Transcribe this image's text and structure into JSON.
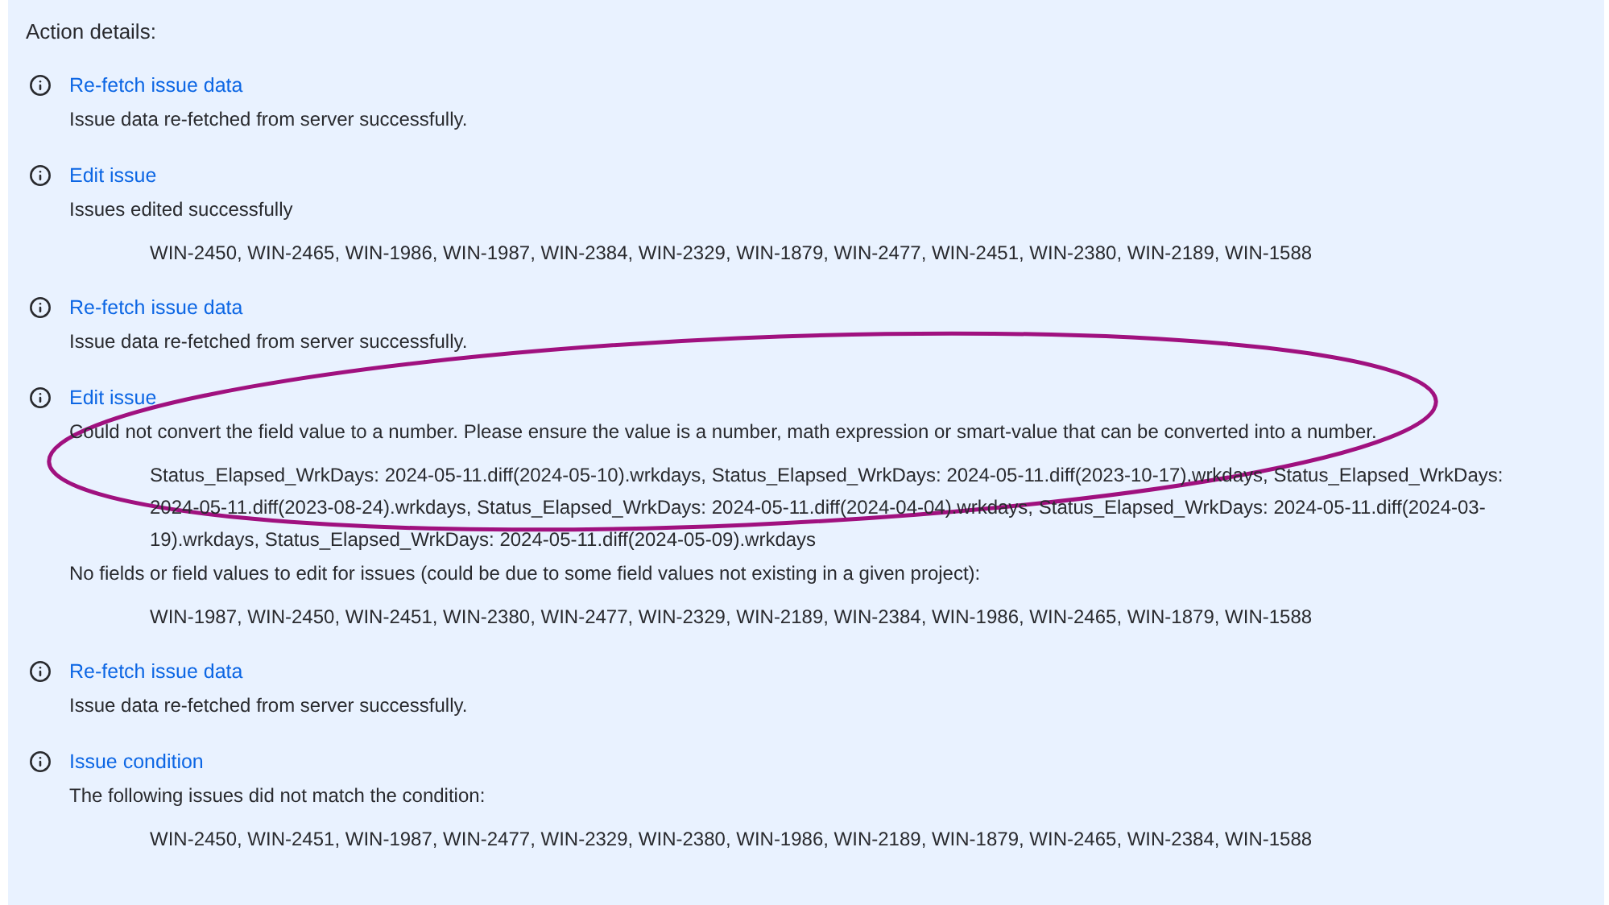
{
  "heading": "Action details:",
  "actions": [
    {
      "title": "Re-fetch issue data",
      "lines": [
        {
          "kind": "message",
          "text": "Issue data re-fetched from server successfully."
        }
      ]
    },
    {
      "title": "Edit issue",
      "lines": [
        {
          "kind": "message",
          "text": "Issues edited successfully"
        },
        {
          "kind": "detail",
          "text": "WIN-2450, WIN-2465, WIN-1986, WIN-1987, WIN-2384, WIN-2329, WIN-1879, WIN-2477, WIN-2451, WIN-2380, WIN-2189, WIN-1588"
        }
      ]
    },
    {
      "title": "Re-fetch issue data",
      "lines": [
        {
          "kind": "message",
          "text": "Issue data re-fetched from server successfully."
        }
      ]
    },
    {
      "title": "Edit issue",
      "lines": [
        {
          "kind": "message",
          "text": "Could not convert the field value to a number. Please ensure the value is a number, math expression or smart-value that can be converted into a number."
        },
        {
          "kind": "detail",
          "text": "Status_Elapsed_WrkDays: 2024-05-11.diff(2024-05-10).wrkdays, Status_Elapsed_WrkDays: 2024-05-11.diff(2023-10-17).wrkdays, Status_Elapsed_WrkDays: 2024-05-11.diff(2023-08-24).wrkdays, Status_Elapsed_WrkDays: 2024-05-11.diff(2024-04-04).wrkdays, Status_Elapsed_WrkDays: 2024-05-11.diff(2024-03-19).wrkdays, Status_Elapsed_WrkDays: 2024-05-11.diff(2024-05-09).wrkdays"
        },
        {
          "kind": "message",
          "text": "No fields or field values to edit for issues (could be due to some field values not existing in a given project):"
        },
        {
          "kind": "detail",
          "text": "WIN-1987, WIN-2450, WIN-2451, WIN-2380, WIN-2477, WIN-2329, WIN-2189, WIN-2384, WIN-1986, WIN-2465, WIN-1879, WIN-1588"
        }
      ],
      "circled": true
    },
    {
      "title": "Re-fetch issue data",
      "lines": [
        {
          "kind": "message",
          "text": "Issue data re-fetched from server successfully."
        }
      ]
    },
    {
      "title": "Issue condition",
      "lines": [
        {
          "kind": "message",
          "text": "The following issues did not match the condition:"
        },
        {
          "kind": "detail",
          "text": "WIN-2450, WIN-2451, WIN-1987, WIN-2477, WIN-2329, WIN-2380, WIN-1986, WIN-2189, WIN-1879, WIN-2465, WIN-2384, WIN-1588"
        }
      ]
    }
  ]
}
